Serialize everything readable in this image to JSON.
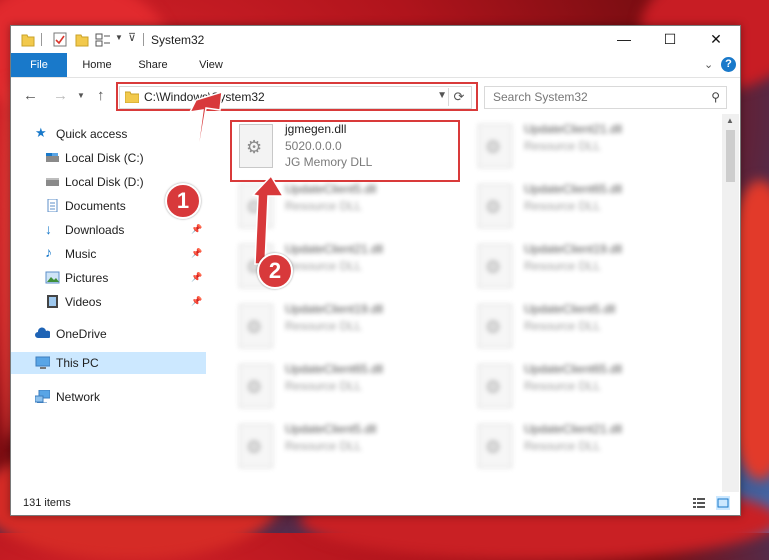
{
  "window": {
    "title": "System32",
    "controls": {
      "minimize": "—",
      "maximize": "☐",
      "close": "✕"
    }
  },
  "ribbon": {
    "tabs": [
      "File",
      "Home",
      "Share",
      "View"
    ],
    "help": "?"
  },
  "nav": {
    "address": "C:\\Windows\\System32",
    "search_placeholder": "Search System32"
  },
  "sidebar": {
    "items": [
      {
        "label": "Quick access",
        "icon": "star-icon"
      },
      {
        "label": "Local Disk (C:)",
        "icon": "drive-icon"
      },
      {
        "label": "Local Disk (D:)",
        "icon": "drive-icon"
      },
      {
        "label": "Documents",
        "icon": "documents-icon"
      },
      {
        "label": "Downloads",
        "icon": "download-icon"
      },
      {
        "label": "Music",
        "icon": "music-icon"
      },
      {
        "label": "Pictures",
        "icon": "pictures-icon"
      },
      {
        "label": "Videos",
        "icon": "videos-icon"
      },
      {
        "label": "OneDrive",
        "icon": "cloud-icon"
      },
      {
        "label": "This PC",
        "icon": "computer-icon"
      },
      {
        "label": "Network",
        "icon": "network-icon"
      }
    ]
  },
  "files": {
    "highlighted": {
      "name": "jgmegen.dll",
      "version": "5020.0.0.0",
      "description": "JG Memory DLL"
    },
    "left_column": [
      {
        "name": "UpdateClient5.dll",
        "type": "Resource DLL"
      },
      {
        "name": "UpdateClient21.dll",
        "type": "Resource DLL"
      },
      {
        "name": "UpdateClient19.dll",
        "type": "Resource DLL"
      },
      {
        "name": "UpdateClient65.dll",
        "type": "Resource DLL"
      },
      {
        "name": "UpdateClient5.dll",
        "type": "Resource DLL"
      }
    ],
    "right_column": [
      {
        "name": "UpdateClient21.dll",
        "type": "Resource DLL"
      },
      {
        "name": "UpdateClient65.dll",
        "type": "Resource DLL"
      },
      {
        "name": "UpdateClient19.dll",
        "type": "Resource DLL"
      },
      {
        "name": "UpdateClient5.dll",
        "type": "Resource DLL"
      },
      {
        "name": "UpdateClient65.dll",
        "type": "Resource DLL"
      },
      {
        "name": "UpdateClient21.dll",
        "type": "Resource DLL"
      }
    ]
  },
  "status": {
    "count": "131 items"
  },
  "annotations": {
    "step1": "1",
    "step2": "2"
  },
  "colors": {
    "accent": "#1979ca",
    "callout": "#d8393b",
    "selection": "#cce8ff"
  }
}
